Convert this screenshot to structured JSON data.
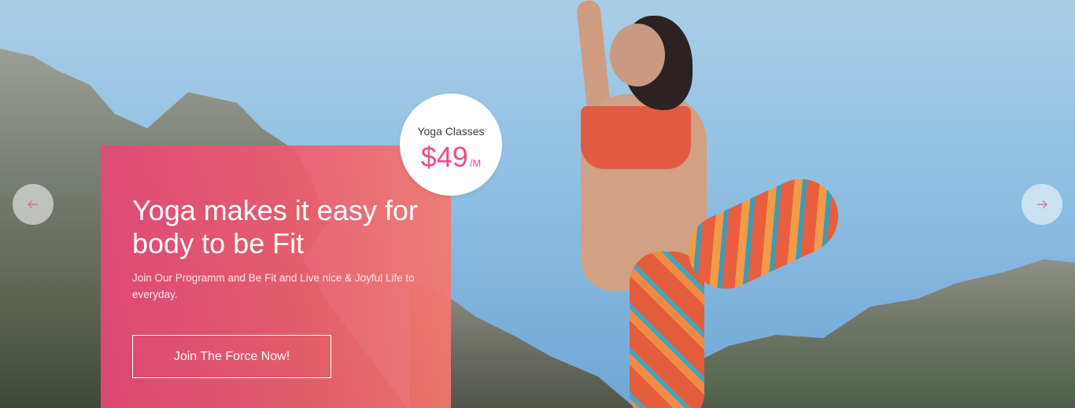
{
  "promo": {
    "headline": "Yoga makes it easy for body to be Fit",
    "subtext": "Join Our Programm and Be Fit and Live nice & Joyful Life to everyday.",
    "cta_label": "Join The Force Now!"
  },
  "pricing": {
    "label": "Yoga Classes",
    "price": "$49",
    "unit": "/M"
  },
  "slider": {
    "prev_icon": "arrow-left-icon",
    "next_icon": "arrow-right-icon"
  },
  "colors": {
    "accent_pink": "#ef4b8b",
    "box_start": "#e84678",
    "box_end": "#f5786c"
  }
}
